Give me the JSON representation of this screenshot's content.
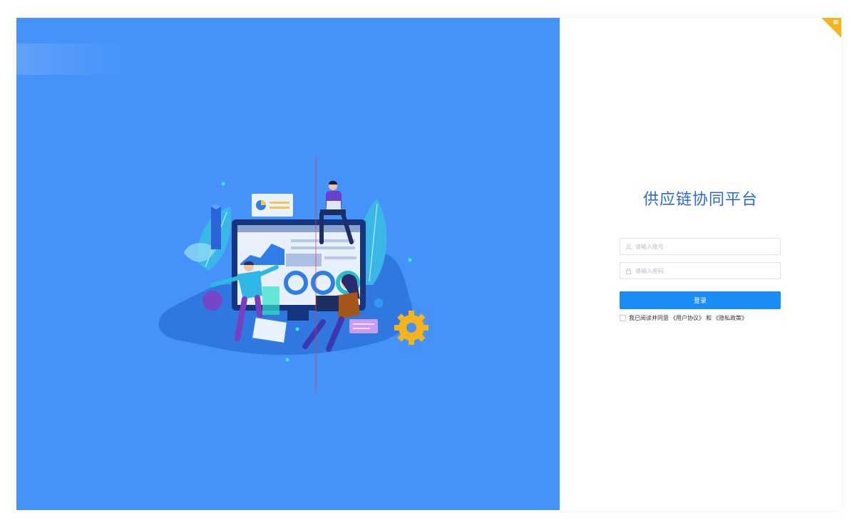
{
  "app": {
    "title": "供应链协同平台"
  },
  "login": {
    "account_placeholder": "请输入账号",
    "password_placeholder": "请输入密码",
    "submit_label": "登录"
  },
  "agreement": {
    "prefix": "我已阅读并同意",
    "user_agreement": "《用户协议》",
    "conjunction": "和",
    "privacy_policy": "《隐私政策》",
    "checked": false
  },
  "icons": {
    "account_icon": "user-icon",
    "password_icon": "lock-icon",
    "corner_icon": "qr-code-icon"
  },
  "colors": {
    "left_panel_bg": "#4592f9",
    "title": "#2a6bd2",
    "primary_button": "#1a8cf8",
    "corner_ribbon": "#f6b31c"
  }
}
